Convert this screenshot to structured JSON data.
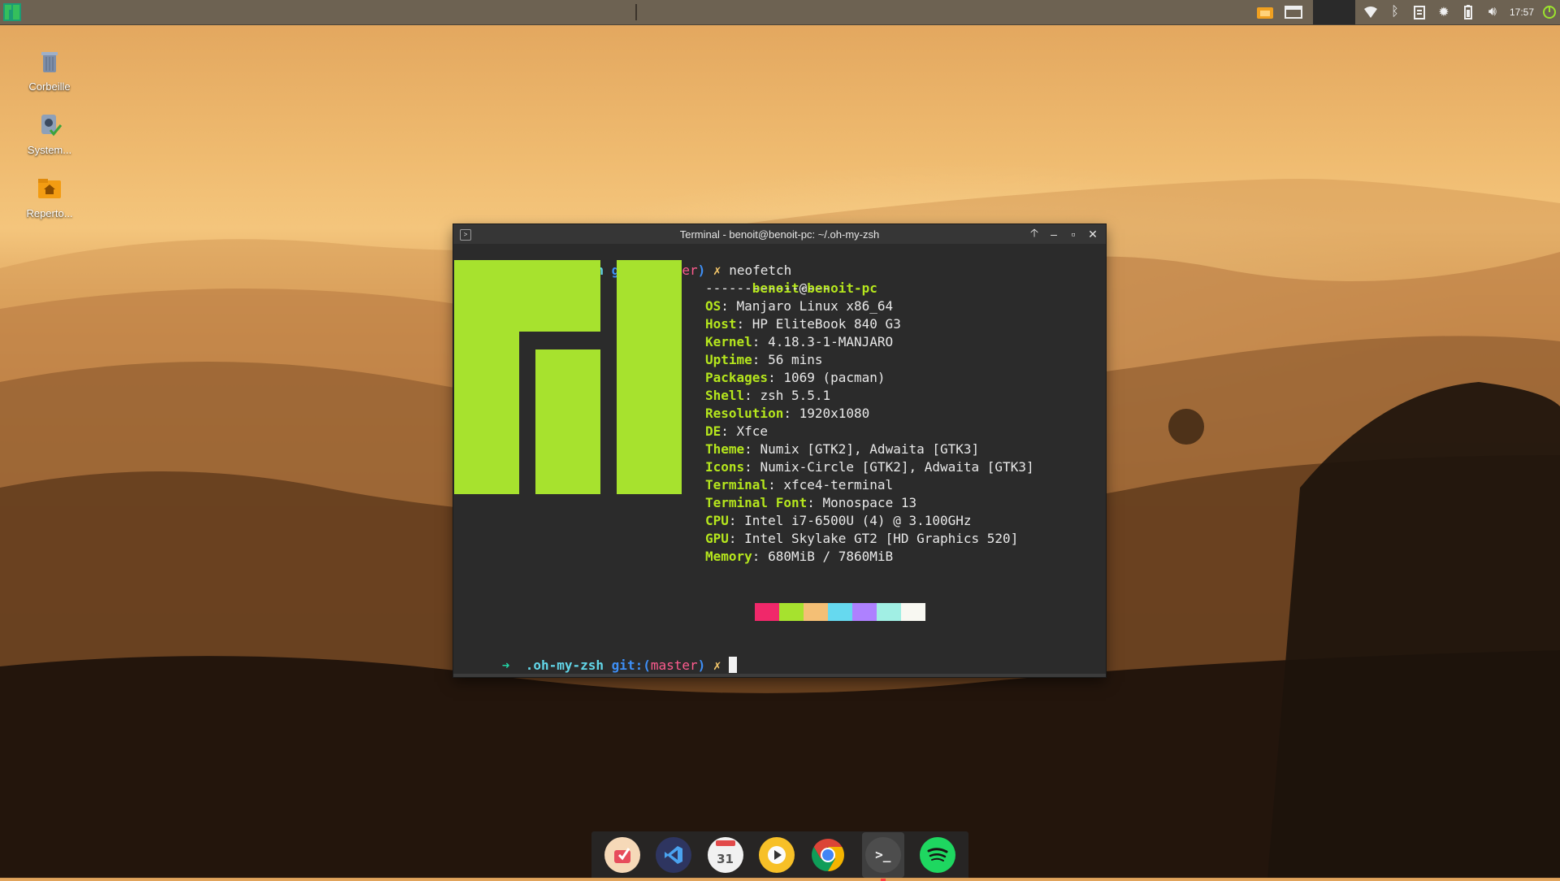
{
  "top_panel": {
    "clock": "17:57",
    "tray_icons": [
      "folder-icon",
      "window-icon",
      "wifi-icon",
      "bluetooth-icon",
      "clipboard-icon",
      "settings-icon",
      "battery-icon",
      "volume-icon",
      "power-icon"
    ]
  },
  "desktop": {
    "icons": [
      {
        "label": "Corbeille",
        "icon": "trash-icon"
      },
      {
        "label": "System...",
        "icon": "drive-icon"
      },
      {
        "label": "Reperto...",
        "icon": "home-folder-icon"
      }
    ]
  },
  "terminal": {
    "title": "Terminal - benoit@benoit-pc: ~/.oh-my-zsh",
    "prompt": {
      "arrow": "➜",
      "dir": ".oh-my-zsh",
      "git": "git:(",
      "branch": "master",
      "git_close": ")",
      "dirty": "✗"
    },
    "command": "neofetch",
    "user_host": {
      "user": "benoit",
      "at": "@",
      "host": "benoit-pc"
    },
    "separator": "----------------",
    "info": [
      {
        "key": "OS",
        "value": "Manjaro Linux x86_64"
      },
      {
        "key": "Host",
        "value": "HP EliteBook 840 G3"
      },
      {
        "key": "Kernel",
        "value": "4.18.3-1-MANJARO"
      },
      {
        "key": "Uptime",
        "value": "56 mins"
      },
      {
        "key": "Packages",
        "value": "1069 (pacman)"
      },
      {
        "key": "Shell",
        "value": "zsh 5.5.1"
      },
      {
        "key": "Resolution",
        "value": "1920x1080"
      },
      {
        "key": "DE",
        "value": "Xfce"
      },
      {
        "key": "Theme",
        "value": "Numix [GTK2], Adwaita [GTK3]"
      },
      {
        "key": "Icons",
        "value": "Numix-Circle [GTK2], Adwaita [GTK3]"
      },
      {
        "key": "Terminal",
        "value": "xfce4-terminal"
      },
      {
        "key": "Terminal Font",
        "value": "Monospace 13"
      },
      {
        "key": "CPU",
        "value": "Intel i7-6500U (4) @ 3.100GHz"
      },
      {
        "key": "GPU",
        "value": "Intel Skylake GT2 [HD Graphics 520]"
      },
      {
        "key": "Memory",
        "value": "680MiB / 7860MiB"
      }
    ],
    "palette": [
      "#2b2b2b",
      "#f0286a",
      "#a6e22e",
      "#f4bf75",
      "#66d9ef",
      "#ae81ff",
      "#a1efe4",
      "#f8f8f2"
    ],
    "logo_color": "#a7e22e",
    "buttons": [
      "up-arrow-icon",
      "minimize-icon",
      "maximize-icon",
      "close-icon"
    ]
  },
  "dock": {
    "items": [
      "kupfer-icon",
      "vscode-icon",
      "calendar-icon",
      "media-player-icon",
      "chrome-icon",
      "terminal-icon",
      "spotify-icon"
    ],
    "calendar_day": "31",
    "terminal_glyph": ">_"
  }
}
